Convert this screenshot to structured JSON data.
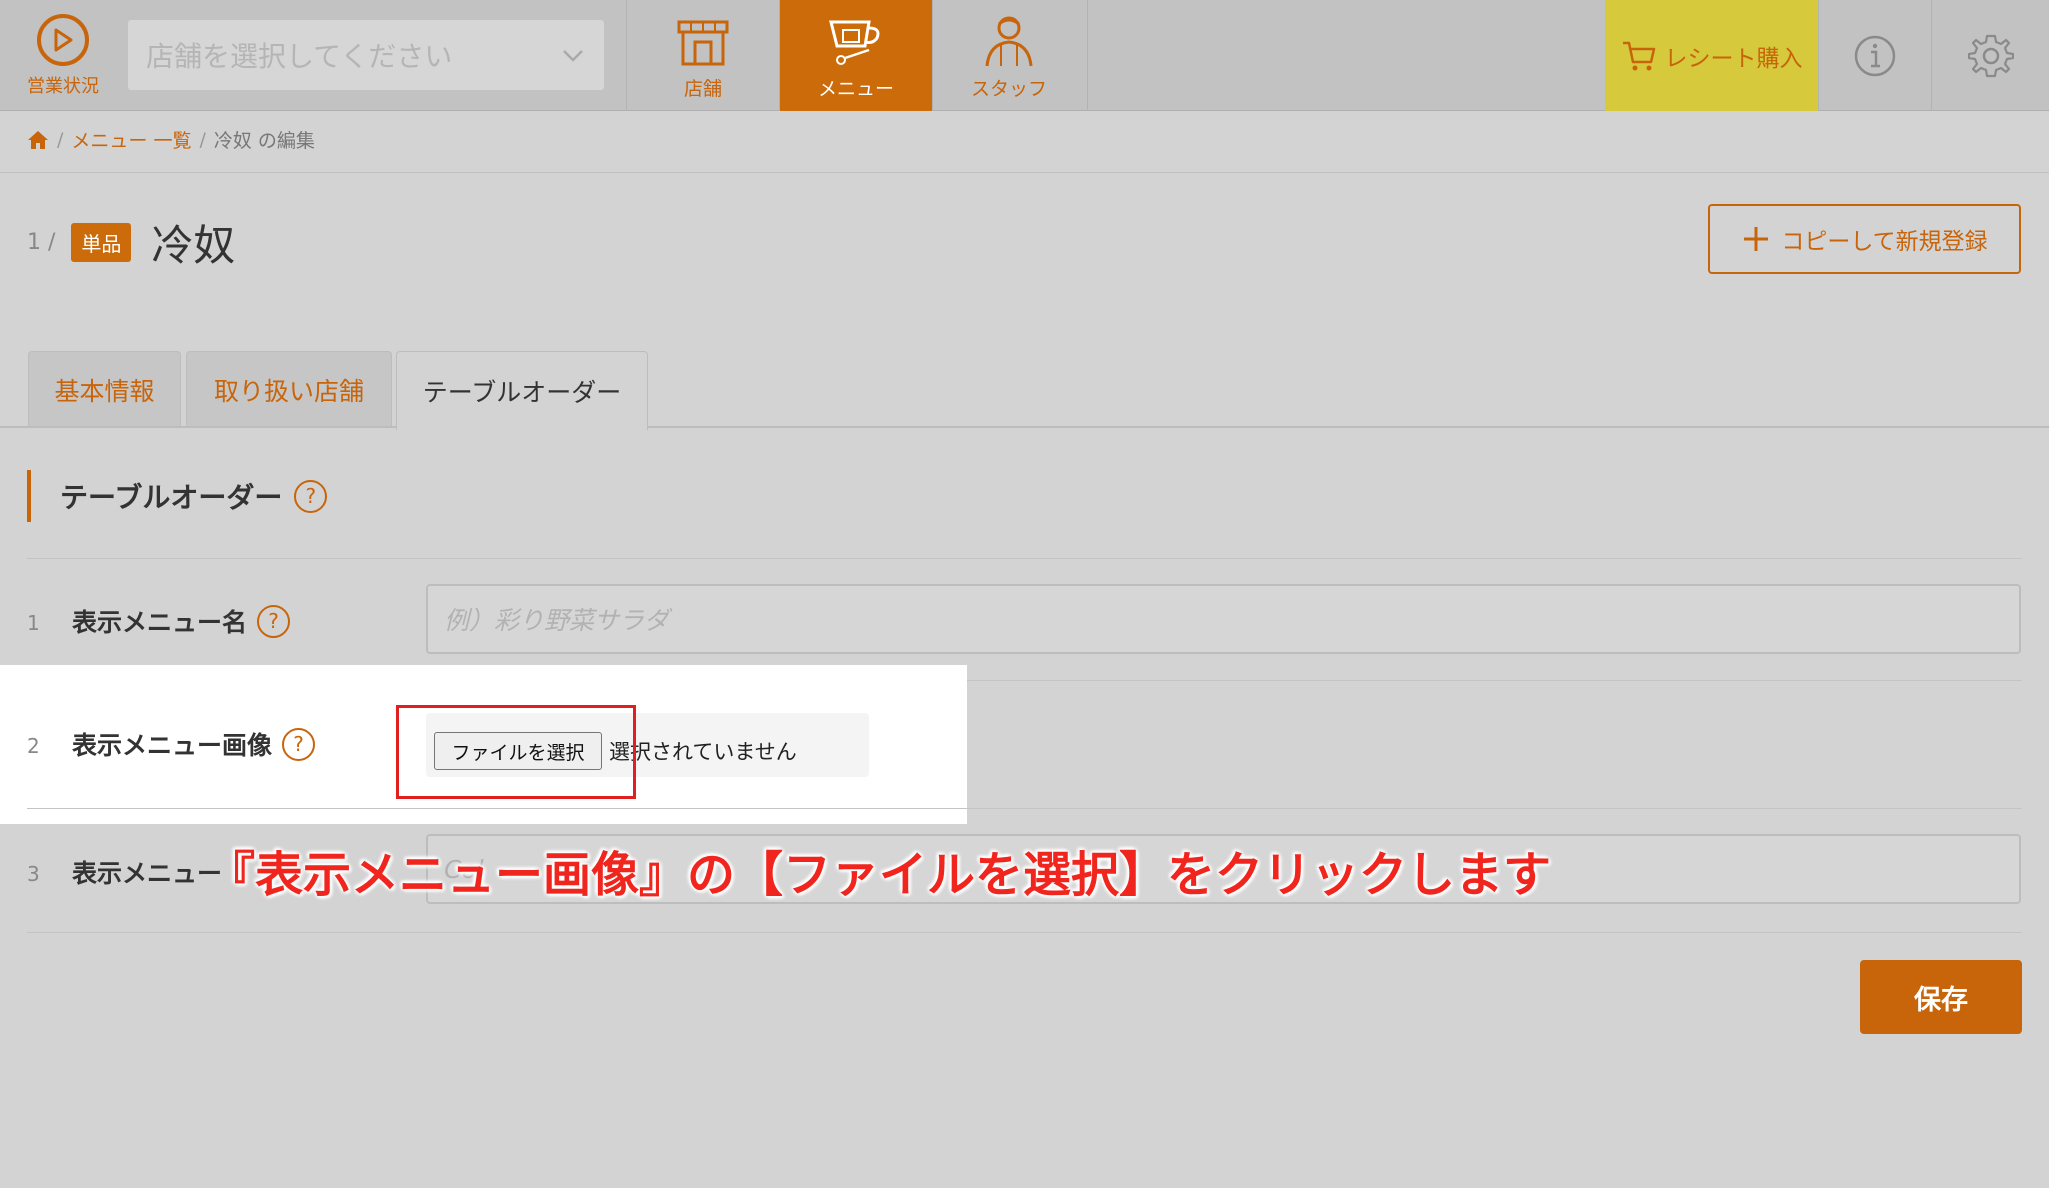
{
  "nav": {
    "status_label": "営業状況",
    "store_placeholder": "店舗を選択してください",
    "tabs": [
      {
        "label": "店舗",
        "icon": "store-icon"
      },
      {
        "label": "メニュー",
        "icon": "teacup-icon"
      },
      {
        "label": "スタッフ",
        "icon": "staff-icon"
      }
    ],
    "active_tab": "メニュー",
    "receipt_label": "レシート購入",
    "accent_color": "#cc6b0a",
    "receipt_color": "#d6c93c"
  },
  "breadcrumb": {
    "items": [
      "メニュー 一覧"
    ],
    "current": "冷奴 の編集"
  },
  "header": {
    "index": "1 /",
    "badge": "単品",
    "title": "冷奴",
    "copy_button": "コピーして新規登録"
  },
  "tabs": [
    "基本情報",
    "取り扱い店舗",
    "テーブルオーダー"
  ],
  "section": {
    "title": "テーブルオーダー",
    "help": "?"
  },
  "rows": [
    {
      "num": "1",
      "label": "表示メニュー名",
      "placeholder": "例）彩り野菜サラダ"
    },
    {
      "num": "2",
      "label": "表示メニュー画像",
      "file_button": "ファイルを選択",
      "file_status": "選択されていません"
    },
    {
      "num": "3",
      "label": "表示メニュー",
      "placeholder": "Col"
    }
  ],
  "annotation": "『表示メニュー画像』の【ファイルを選択】をクリックします",
  "save_label": "保存"
}
